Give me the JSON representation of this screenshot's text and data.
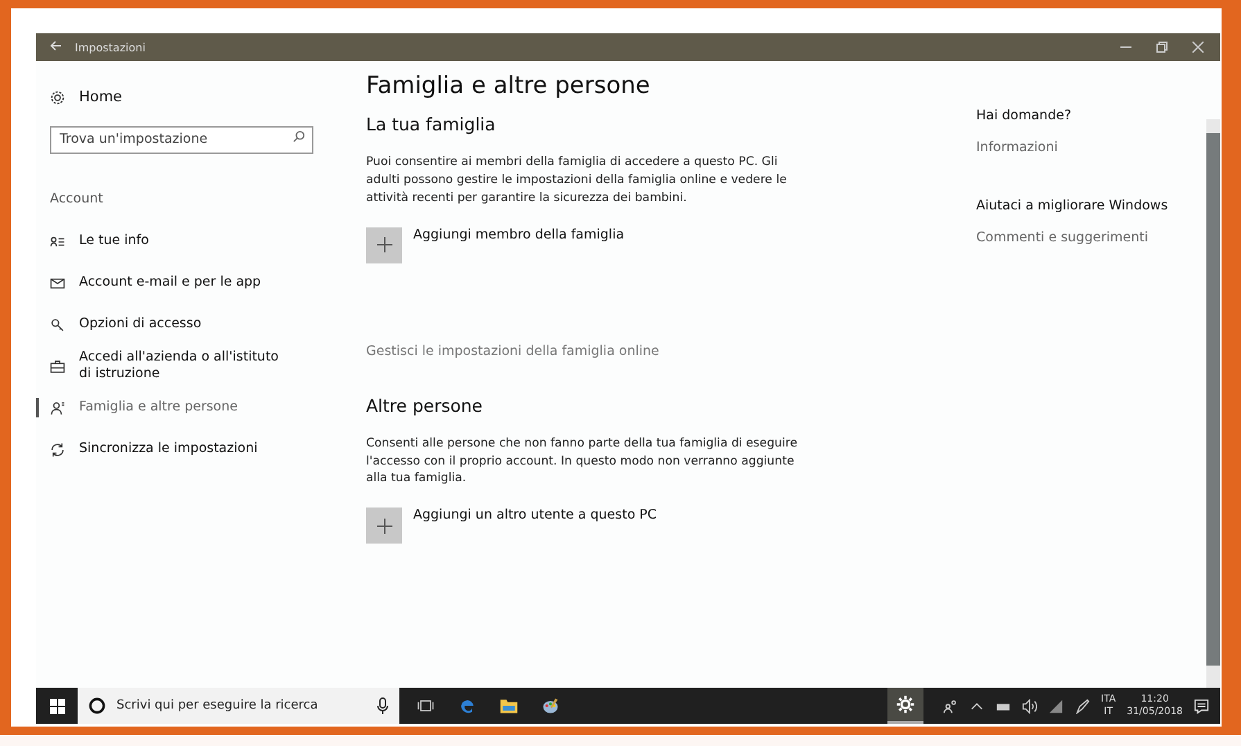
{
  "window": {
    "title": "Impostazioni"
  },
  "sidebar": {
    "home": "Home",
    "search": {
      "placeholder": "Trova un'impostazione"
    },
    "section": "Account",
    "items": [
      {
        "label": "Le tue info",
        "selected": false
      },
      {
        "label": "Account e-mail e per le app",
        "selected": false
      },
      {
        "label": "Opzioni di accesso",
        "selected": false
      },
      {
        "label": "Accedi all'azienda o all'istituto di istruzione",
        "selected": false
      },
      {
        "label": "Famiglia e altre persone",
        "selected": true
      },
      {
        "label": "Sincronizza le impostazioni",
        "selected": false
      }
    ]
  },
  "main": {
    "title": "Famiglia e altre persone",
    "sections": [
      {
        "heading": "La tua famiglia",
        "text": "Puoi consentire ai membri della famiglia di accedere a questo PC. Gli adulti possono gestire le impostazioni della famiglia online e vedere le attività recenti per garantire la sicurezza dei bambini.",
        "add": "Aggiungi membro della famiglia",
        "link": "Gestisci le impostazioni della famiglia online"
      },
      {
        "heading": "Altre persone",
        "text": "Consenti alle persone che non fanno parte della tua famiglia di eseguire l'accesso con il proprio account. In questo modo non verranno aggiunte alla tua famiglia.",
        "add": "Aggiungi un altro utente a questo PC"
      }
    ]
  },
  "aside": [
    {
      "heading": "Hai domande?",
      "link": "Informazioni"
    },
    {
      "heading": "Aiutaci a migliorare Windows",
      "link": "Commenti e suggerimenti"
    }
  ],
  "taskbar": {
    "search": {
      "placeholder": "Scrivi qui per eseguire la ricerca"
    },
    "apps": [
      {
        "selected": false
      },
      {
        "selected": false
      },
      {
        "selected": false
      },
      {
        "selected": false
      },
      {
        "selected": true
      }
    ],
    "language": [
      "ITA",
      "IT"
    ],
    "time": "11:20",
    "date": "31/05/2018"
  }
}
